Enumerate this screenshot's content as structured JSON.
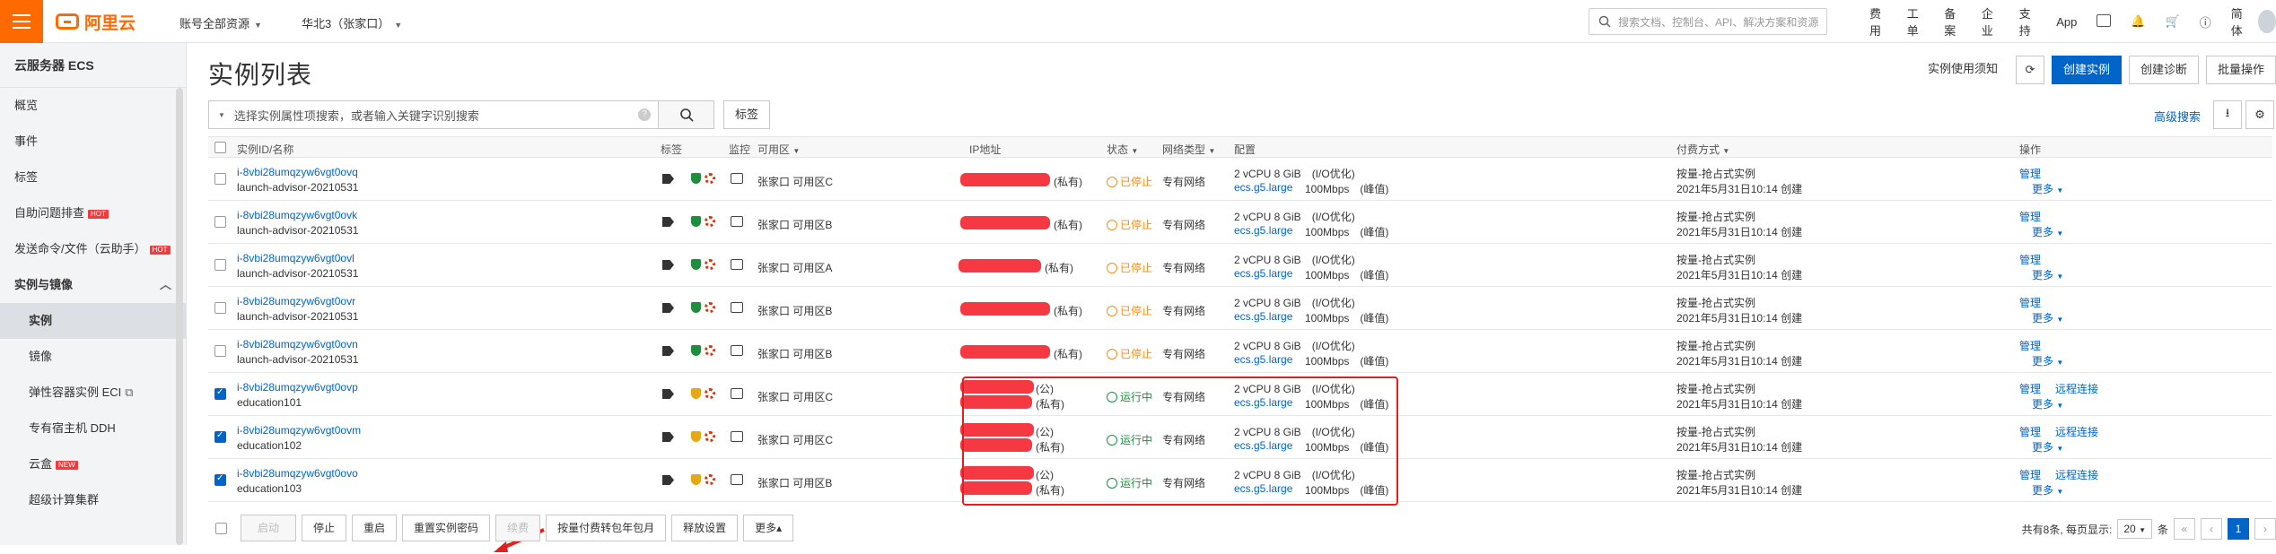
{
  "topbar": {
    "brand": "阿里云",
    "account_scope": "账号全部资源",
    "region": "华北3（张家口）",
    "search_placeholder": "搜索文档、控制台、API、解决方案和资源",
    "links": [
      "费用",
      "工单",
      "备案",
      "企业",
      "支持",
      "App"
    ],
    "language": "简体"
  },
  "sidebar": {
    "title": "云服务器 ECS",
    "items": [
      {
        "label": "概览"
      },
      {
        "label": "事件"
      },
      {
        "label": "标签"
      },
      {
        "label": "自助问题排查",
        "badge": "HOT"
      },
      {
        "label": "发送命令/文件（云助手）",
        "badge": "HOT"
      }
    ],
    "group": {
      "label": "实例与镜像"
    },
    "sub_items": [
      {
        "label": "实例",
        "active": true
      },
      {
        "label": "镜像"
      },
      {
        "label": "弹性容器实例 ECI"
      },
      {
        "label": "专有宿主机 DDH"
      },
      {
        "label": "云盒",
        "badge": "NEW"
      },
      {
        "label": "超级计算集群"
      }
    ]
  },
  "main": {
    "title": "实例列表",
    "header_buttons": {
      "notice": "实例使用须知",
      "create": "创建实例",
      "diagnose": "创建诊断",
      "batch": "批量操作"
    },
    "filter_placeholder": "选择实例属性项搜索，或者输入关键字识别搜索",
    "tag_button": "标签",
    "advanced_search": "高级搜索",
    "columns": {
      "id": "实例ID/名称",
      "tags": "标签",
      "monitor": "监控",
      "zone": "可用区",
      "ip": "IP地址",
      "status": "状态",
      "network": "网络类型",
      "config": "配置",
      "billing": "付费方式",
      "actions": "操作"
    },
    "rows": [
      {
        "id": "i-8vbi28umqzyw6vgt0ovq",
        "name": "launch-advisor-20210531",
        "zone": "张家口 可用区C",
        "ip_suffix": "(私有)",
        "status": "已停止",
        "running": false,
        "network": "专有网络",
        "spec": "2 vCPU 8 GiB　(I/O优化)",
        "type": "ecs.g5.large",
        "bw": "100Mbps　(峰值)",
        "billing": "按量-抢占式实例",
        "created": "2021年5月31日10:14 创建",
        "manage": "管理",
        "more": "更多",
        "remote": "",
        "checked": false
      },
      {
        "id": "i-8vbi28umqzyw6vgt0ovk",
        "name": "launch-advisor-20210531",
        "zone": "张家口 可用区B",
        "ip_suffix": "(私有)",
        "status": "已停止",
        "running": false,
        "network": "专有网络",
        "spec": "2 vCPU 8 GiB　(I/O优化)",
        "type": "ecs.g5.large",
        "bw": "100Mbps　(峰值)",
        "billing": "按量-抢占式实例",
        "created": "2021年5月31日10:14 创建",
        "manage": "管理",
        "more": "更多",
        "remote": "",
        "checked": false
      },
      {
        "id": "i-8vbi28umqzyw6vgt0ovl",
        "name": "launch-advisor-20210531",
        "zone": "张家口 可用区A",
        "ip_suffix": "(私有)",
        "status": "已停止",
        "running": false,
        "network": "专有网络",
        "spec": "2 vCPU 8 GiB　(I/O优化)",
        "type": "ecs.g5.large",
        "bw": "100Mbps　(峰值)",
        "billing": "按量-抢占式实例",
        "created": "2021年5月31日10:14 创建",
        "manage": "管理",
        "more": "更多",
        "remote": "",
        "checked": false
      },
      {
        "id": "i-8vbi28umqzyw6vgt0ovr",
        "name": "launch-advisor-20210531",
        "zone": "张家口 可用区B",
        "ip_suffix": "(私有)",
        "status": "已停止",
        "running": false,
        "network": "专有网络",
        "spec": "2 vCPU 8 GiB　(I/O优化)",
        "type": "ecs.g5.large",
        "bw": "100Mbps　(峰值)",
        "billing": "按量-抢占式实例",
        "created": "2021年5月31日10:14 创建",
        "manage": "管理",
        "more": "更多",
        "remote": "",
        "checked": false
      },
      {
        "id": "i-8vbi28umqzyw6vgt0ovn",
        "name": "launch-advisor-20210531",
        "zone": "张家口 可用区B",
        "ip_suffix": "(私有)",
        "status": "已停止",
        "running": false,
        "network": "专有网络",
        "spec": "2 vCPU 8 GiB　(I/O优化)",
        "type": "ecs.g5.large",
        "bw": "100Mbps　(峰值)",
        "billing": "按量-抢占式实例",
        "created": "2021年5月31日10:14 创建",
        "manage": "管理",
        "more": "更多",
        "remote": "",
        "checked": false
      },
      {
        "id": "i-8vbi28umqzyw6vgt0ovp",
        "name": "education101",
        "zone": "张家口 可用区C",
        "ip_public": "(公)",
        "ip_suffix": "(私有)",
        "status": "运行中",
        "running": true,
        "network": "专有网络",
        "spec": "2 vCPU 8 GiB　(I/O优化)",
        "type": "ecs.g5.large",
        "bw": "100Mbps　(峰值)",
        "billing": "按量-抢占式实例",
        "created": "2021年5月31日10:14 创建",
        "manage": "管理",
        "more": "更多",
        "remote": "远程连接",
        "checked": true
      },
      {
        "id": "i-8vbi28umqzyw6vgt0ovm",
        "name": "education102",
        "zone": "张家口 可用区C",
        "ip_public": "(公)",
        "ip_suffix": "(私有)",
        "status": "运行中",
        "running": true,
        "network": "专有网络",
        "spec": "2 vCPU 8 GiB　(I/O优化)",
        "type": "ecs.g5.large",
        "bw": "100Mbps　(峰值)",
        "billing": "按量-抢占式实例",
        "created": "2021年5月31日10:14 创建",
        "manage": "管理",
        "more": "更多",
        "remote": "远程连接",
        "checked": true
      },
      {
        "id": "i-8vbi28umqzyw6vgt0ovo",
        "name": "education103",
        "zone": "张家口 可用区B",
        "ip_public": "(公)",
        "ip_suffix": "(私有)",
        "status": "运行中",
        "running": true,
        "network": "专有网络",
        "spec": "2 vCPU 8 GiB　(I/O优化)",
        "type": "ecs.g5.large",
        "bw": "100Mbps　(峰值)",
        "billing": "按量-抢占式实例",
        "created": "2021年5月31日10:14 创建",
        "manage": "管理",
        "more": "更多",
        "remote": "远程连接",
        "checked": true
      }
    ],
    "footer": {
      "buttons": [
        "启动",
        "停止",
        "重启",
        "重置实例密码",
        "续费",
        "按量付费转包年包月",
        "释放设置",
        "更多▴"
      ],
      "summary": "共有8条, 每页显示:",
      "page_size": "20",
      "unit": "条",
      "current_page": "1"
    }
  },
  "colors": {
    "accent": "#0064c8",
    "brand": "#ff6a00",
    "stopped": "#f98e1a",
    "running": "#1e8e3e",
    "highlight": "#e02020"
  }
}
